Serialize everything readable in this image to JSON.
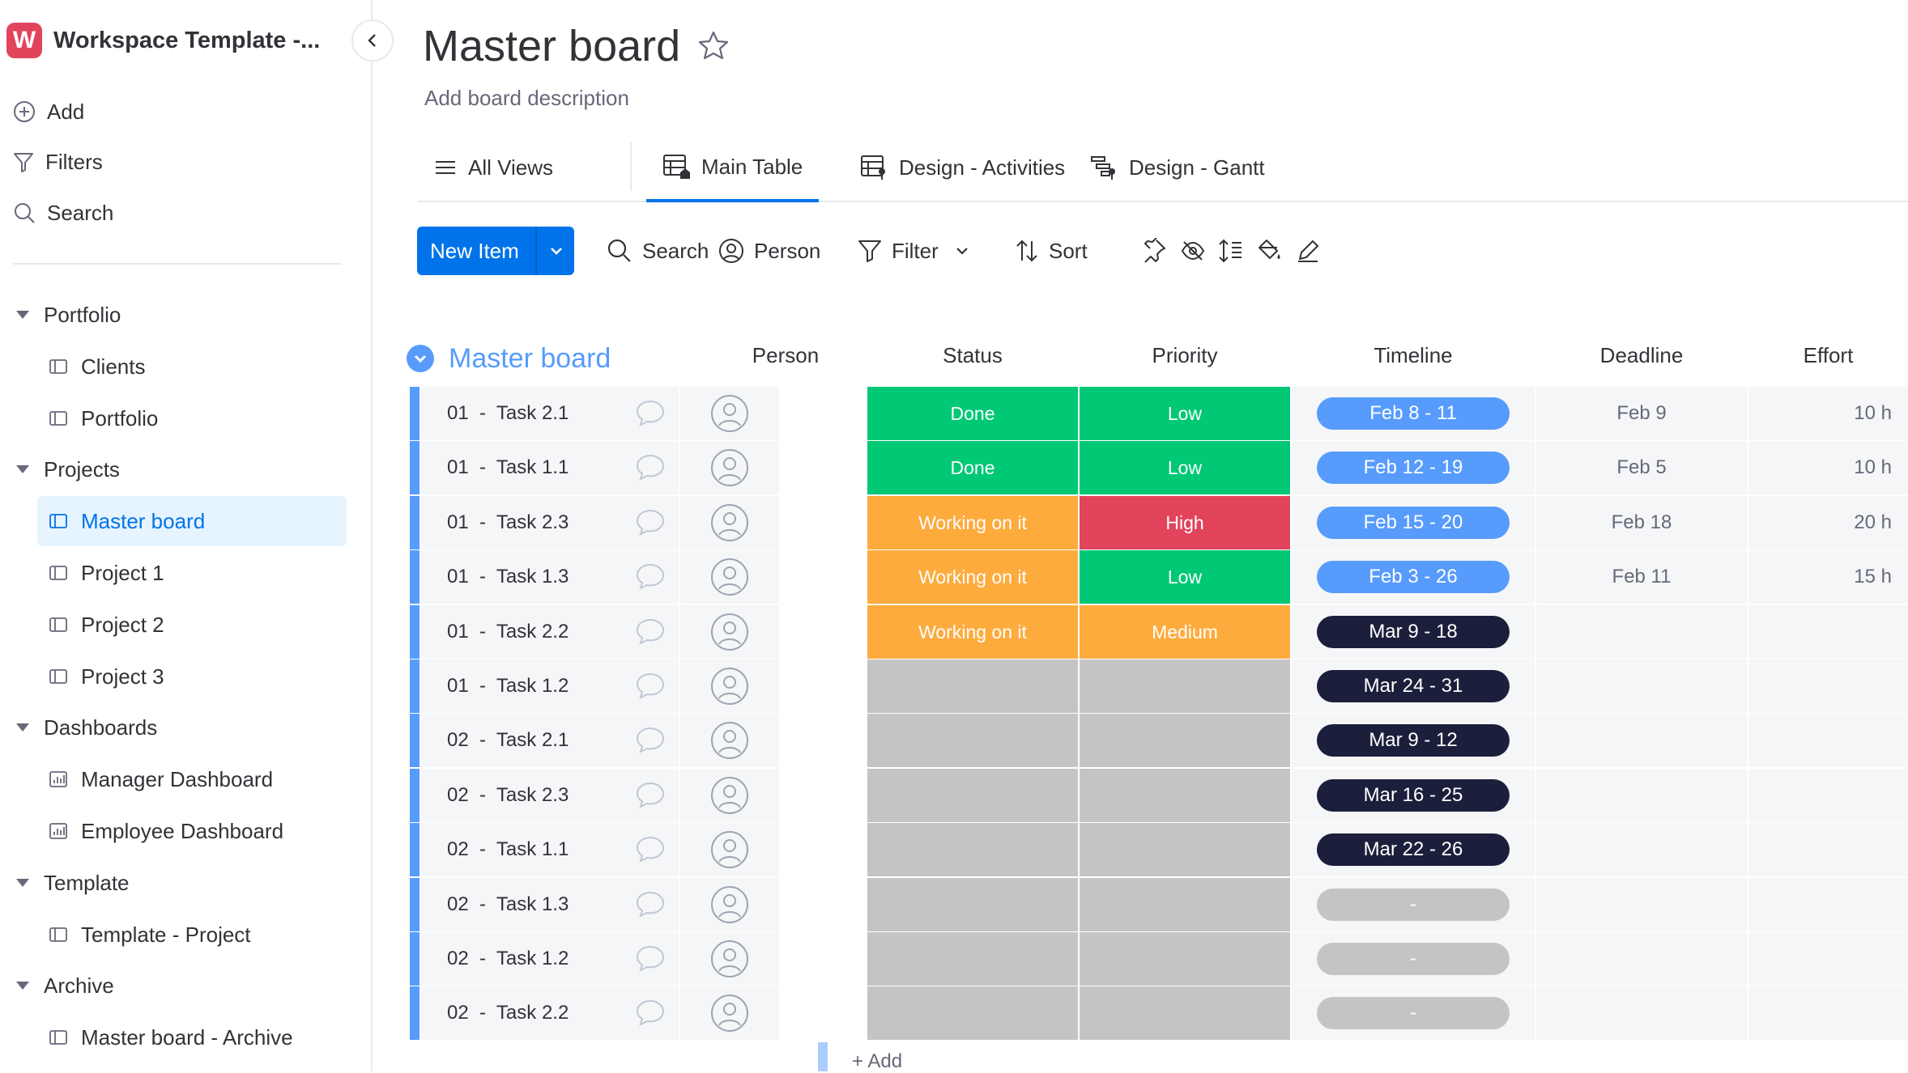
{
  "sidebar": {
    "workspace_logo": "W",
    "workspace_title": "Workspace Template -...",
    "actions": {
      "add": "Add",
      "filters": "Filters",
      "search": "Search"
    },
    "tree": [
      {
        "type": "folder",
        "label": "Portfolio"
      },
      {
        "type": "board",
        "label": "Clients"
      },
      {
        "type": "board",
        "label": "Portfolio"
      },
      {
        "type": "folder",
        "label": "Projects"
      },
      {
        "type": "board",
        "label": "Master board",
        "active": true
      },
      {
        "type": "board",
        "label": "Project 1"
      },
      {
        "type": "board",
        "label": "Project 2"
      },
      {
        "type": "board",
        "label": "Project 3"
      },
      {
        "type": "folder",
        "label": "Dashboards"
      },
      {
        "type": "dashboard",
        "label": "Manager Dashboard"
      },
      {
        "type": "dashboard",
        "label": "Employee Dashboard"
      },
      {
        "type": "folder",
        "label": "Template"
      },
      {
        "type": "board",
        "label": "Template - Project"
      },
      {
        "type": "folder",
        "label": "Archive"
      },
      {
        "type": "board",
        "label": "Master board - Archive"
      }
    ]
  },
  "board": {
    "title": "Master board",
    "description": "Add board description"
  },
  "views": {
    "all_views": "All Views",
    "tabs": [
      {
        "label": "Main Table",
        "active": true
      },
      {
        "label": "Design - Activities"
      },
      {
        "label": "Design - Gantt"
      }
    ]
  },
  "toolbar": {
    "new_item": "New Item",
    "search": "Search",
    "person": "Person",
    "filter": "Filter",
    "sort": "Sort"
  },
  "group": {
    "name": "Master board",
    "color": "#579bfc",
    "columns": {
      "person": "Person",
      "status": "Status",
      "priority": "Priority",
      "timeline": "Timeline",
      "deadline": "Deadline",
      "effort": "Effort"
    },
    "add_label": "+ Add"
  },
  "colors": {
    "done": "#00c875",
    "working": "#fdab3d",
    "high": "#e2445c",
    "low": "#00c875",
    "medium": "#fdab3d",
    "empty": "#c4c4c4",
    "timeline_current": "#579bfc",
    "timeline_future": "#1c1f3b",
    "timeline_empty": "#c4c4c4",
    "accent": "#0073ea"
  },
  "rows": [
    {
      "name": "01  -  Task 2.1",
      "status": "Done",
      "status_key": "done",
      "priority": "Low",
      "priority_key": "low",
      "timeline": "Feb 8 - 11",
      "timeline_key": "current",
      "deadline": "Feb 9",
      "effort": "10 h"
    },
    {
      "name": "01  -  Task 1.1",
      "status": "Done",
      "status_key": "done",
      "priority": "Low",
      "priority_key": "low",
      "timeline": "Feb 12 - 19",
      "timeline_key": "current",
      "deadline": "Feb 5",
      "effort": "10 h"
    },
    {
      "name": "01  -  Task 2.3",
      "status": "Working on it",
      "status_key": "working",
      "priority": "High",
      "priority_key": "high",
      "timeline": "Feb 15 - 20",
      "timeline_key": "current",
      "deadline": "Feb 18",
      "effort": "20 h"
    },
    {
      "name": "01  -  Task 1.3",
      "status": "Working on it",
      "status_key": "working",
      "priority": "Low",
      "priority_key": "low",
      "timeline": "Feb 3 - 26",
      "timeline_key": "current",
      "deadline": "Feb 11",
      "effort": "15 h"
    },
    {
      "name": "01  -  Task 2.2",
      "status": "Working on it",
      "status_key": "working",
      "priority": "Medium",
      "priority_key": "medium",
      "timeline": "Mar 9 - 18",
      "timeline_key": "future",
      "deadline": "",
      "effort": ""
    },
    {
      "name": "01  -  Task 1.2",
      "status": "",
      "status_key": "empty",
      "priority": "",
      "priority_key": "empty",
      "timeline": "Mar 24 - 31",
      "timeline_key": "future",
      "deadline": "",
      "effort": ""
    },
    {
      "name": "02  -  Task 2.1",
      "status": "",
      "status_key": "empty",
      "priority": "",
      "priority_key": "empty",
      "timeline": "Mar 9 - 12",
      "timeline_key": "future",
      "deadline": "",
      "effort": ""
    },
    {
      "name": "02  -  Task 2.3",
      "status": "",
      "status_key": "empty",
      "priority": "",
      "priority_key": "empty",
      "timeline": "Mar 16 - 25",
      "timeline_key": "future",
      "deadline": "",
      "effort": ""
    },
    {
      "name": "02  -  Task 1.1",
      "status": "",
      "status_key": "empty",
      "priority": "",
      "priority_key": "empty",
      "timeline": "Mar 22 - 26",
      "timeline_key": "future",
      "deadline": "",
      "effort": ""
    },
    {
      "name": "02  -  Task 1.3",
      "status": "",
      "status_key": "empty",
      "priority": "",
      "priority_key": "empty",
      "timeline": "-",
      "timeline_key": "empty",
      "deadline": "",
      "effort": ""
    },
    {
      "name": "02  -  Task 1.2",
      "status": "",
      "status_key": "empty",
      "priority": "",
      "priority_key": "empty",
      "timeline": "-",
      "timeline_key": "empty",
      "deadline": "",
      "effort": ""
    },
    {
      "name": "02  -  Task 2.2",
      "status": "",
      "status_key": "empty",
      "priority": "",
      "priority_key": "empty",
      "timeline": "-",
      "timeline_key": "empty",
      "deadline": "",
      "effort": ""
    }
  ]
}
